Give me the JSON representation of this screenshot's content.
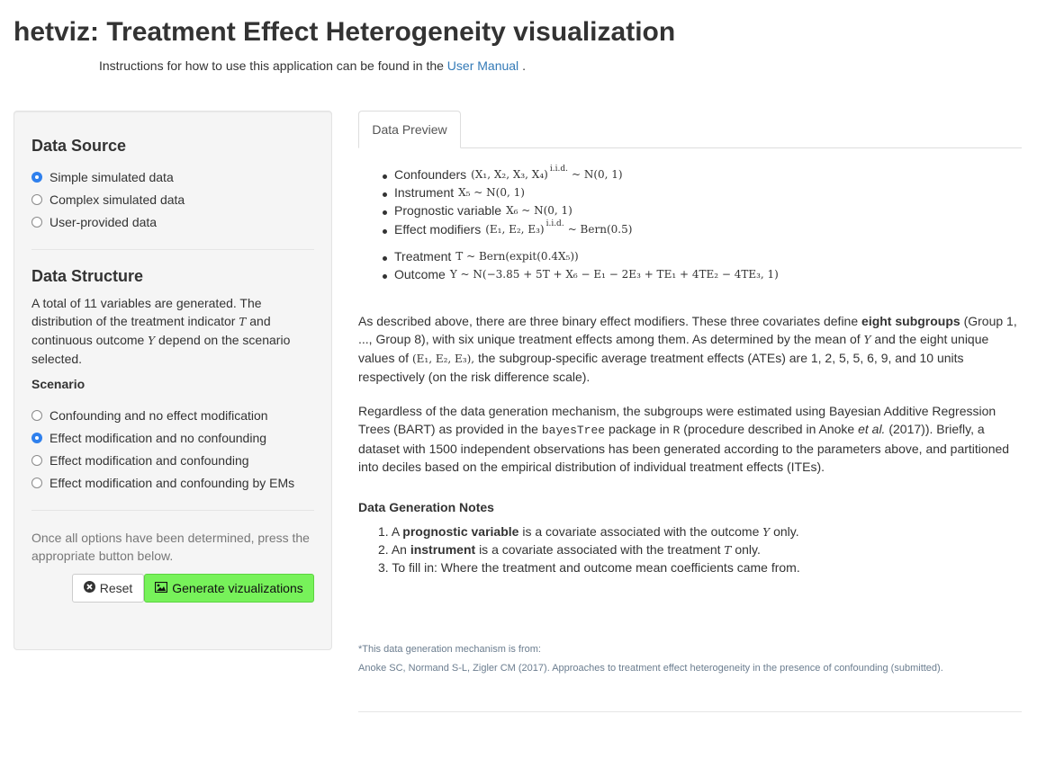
{
  "header": {
    "title": "hetviz: Treatment Effect Heterogeneity visualization",
    "instructions_prefix": "Instructions for how to use this application can be found in the",
    "manual_link": "User Manual",
    "instructions_suffix": "."
  },
  "sidebar": {
    "data_source_heading": "Data Source",
    "data_source_options": [
      "Simple simulated data",
      "Complex simulated data",
      "User-provided data"
    ],
    "data_source_selected": "Simple simulated data",
    "data_structure_heading": "Data Structure",
    "structure_text_1": "A total of 11 variables are generated. The distribution of the treatment indicator",
    "structure_var_T": "T",
    "structure_text_2": "and continuous outcome",
    "structure_var_Y": "Y",
    "structure_text_3": "depend on the scenario selected.",
    "scenario_label": "Scenario",
    "scenario_options": [
      "Confounding and no effect modification",
      "Effect modification and no confounding",
      "Effect modification and confounding",
      "Effect modification and confounding by EMs"
    ],
    "scenario_selected": "Effect modification and no confounding",
    "options_note": "Once all options have been determined, press the appropriate button below.",
    "reset_label": "Reset",
    "generate_label": "Generate vizualizations"
  },
  "main": {
    "tab_label": "Data Preview",
    "bullets_1": [
      {
        "label": "Confounders",
        "math_pre": "(X₁, X₂, X₃, X₄)",
        "iid": "i.i.d.",
        "math_post": "~ N(0, 1)"
      },
      {
        "label": "Instrument",
        "math": "X₅ ~ N(0, 1)"
      },
      {
        "label": "Prognostic variable",
        "math": "X₆ ~ N(0, 1)"
      },
      {
        "label": "Effect modifiers",
        "math_pre": "(E₁, E₂, E₃)",
        "iid": "i.i.d.",
        "math_post": "~ Bern(0.5)"
      }
    ],
    "bullets_2": [
      {
        "label": "Treatment",
        "math": "T ~ Bern(expit(0.4X₅))"
      },
      {
        "label": "Outcome",
        "math": "Y ~ N(−3.85 + 5T + X₆ − E₁ − 2E₃ + TE₁ + 4TE₂ − 4TE₃, 1)"
      }
    ],
    "para1_a": "As described above, there are three binary effect modifiers. These three covariates define",
    "para1_b": "eight subgroups",
    "para1_c": "(Group 1, ..., Group 8), with six unique treatment effects among them. As determined by the mean of",
    "para1_var": "Y",
    "para1_d": "and the eight unique values of",
    "para1_math": "(E₁, E₂, E₃),",
    "para1_e": "the subgroup-specific average treatment effects (ATEs) are 1, 2, 5, 5, 6, 9, and 10 units respectively (on the risk difference scale).",
    "para2_a": "Regardless of the data generation mechanism, the subgroups were estimated using Bayesian Additive Regression Trees (BART) as provided in the",
    "para2_code1": "bayesTree",
    "para2_b": "package in",
    "para2_code2": "R",
    "para2_c": "(procedure described in Anoke",
    "para2_etal": "et al.",
    "para2_d": "(2017)). Briefly, a dataset with 1500 independent observations has been generated according to the parameters above, and partitioned into deciles based on the empirical distribution of individual treatment effects (ITEs).",
    "notes_heading": "Data Generation Notes",
    "notes": [
      {
        "num": "1.",
        "pre": "A",
        "bold": "prognostic variable",
        "post": "is a covariate associated with the outcome",
        "var": "Y",
        "tail": "only."
      },
      {
        "num": "2.",
        "pre": "An",
        "bold": "instrument",
        "post": "is a covariate associated with the treatment",
        "var": "T",
        "tail": "only."
      },
      {
        "num": "3.",
        "pre": "To fill in: Where the treatment and outcome mean coefficients came from.",
        "bold": "",
        "post": "",
        "var": "",
        "tail": ""
      }
    ],
    "footnote_1": "*This data generation mechanism is from:",
    "footnote_2": "Anoke SC, Normand S-L, Zigler CM (2017). Approaches to treatment effect heterogeneity in the presence of confounding (submitted)."
  },
  "colors": {
    "accent_radio": "#2f80ed",
    "generate_button": "#77f25a",
    "link": "#337ab7"
  },
  "icons": {
    "reset": "times-circle-icon",
    "generate": "image-icon"
  }
}
